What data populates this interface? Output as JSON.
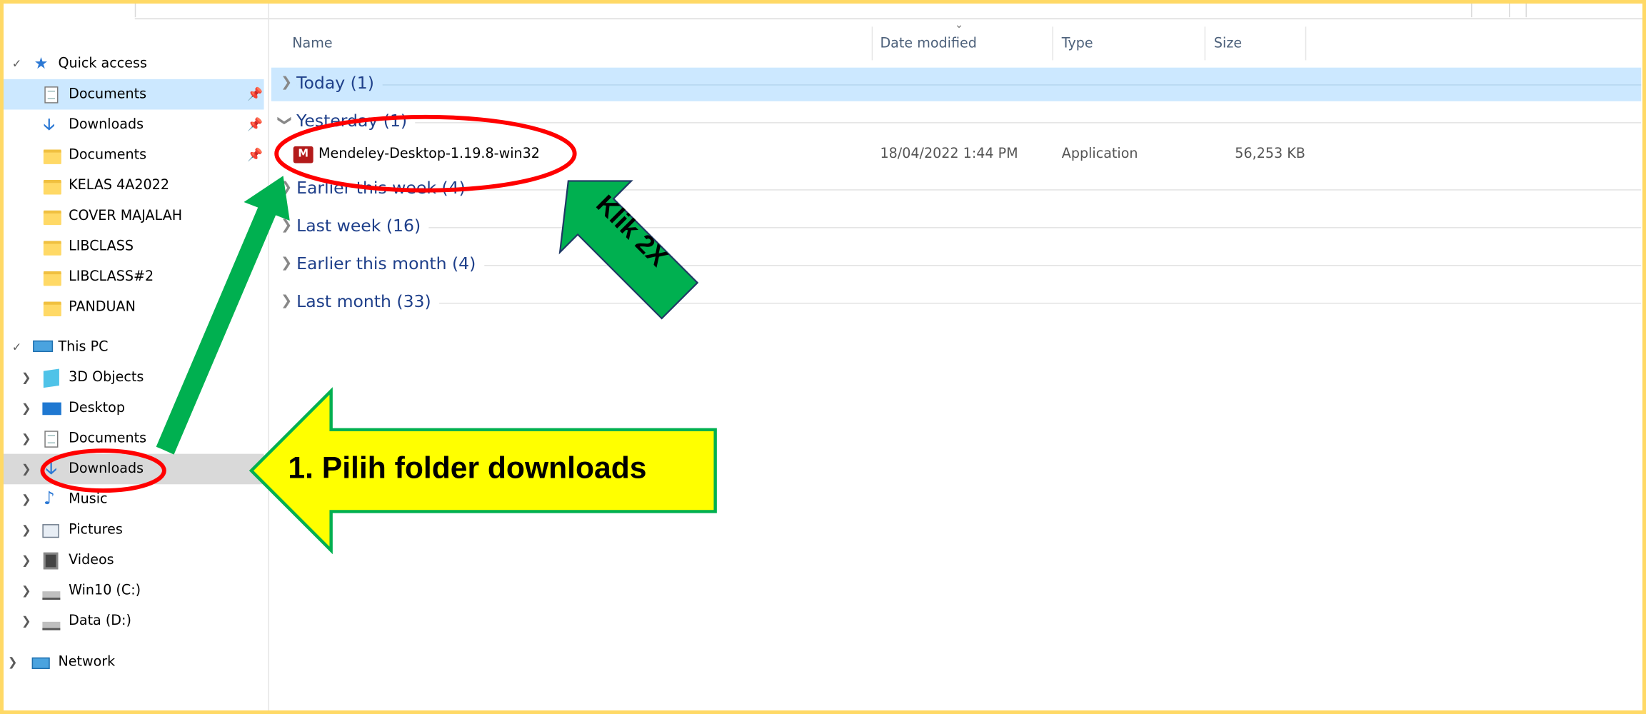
{
  "columns": {
    "name": "Name",
    "date_modified": "Date modified",
    "type": "Type",
    "size": "Size"
  },
  "nav": {
    "quick_access": "Quick access",
    "quick_items": [
      {
        "label": "Documents"
      },
      {
        "label": "Downloads"
      },
      {
        "label": "Documents"
      },
      {
        "label": "KELAS 4A2022"
      },
      {
        "label": "COVER MAJALAH"
      },
      {
        "label": "LIBCLASS"
      },
      {
        "label": "LIBCLASS#2"
      },
      {
        "label": "PANDUAN"
      }
    ],
    "this_pc": "This PC",
    "pc_items": [
      {
        "label": "3D Objects"
      },
      {
        "label": "Desktop"
      },
      {
        "label": "Documents"
      },
      {
        "label": "Downloads"
      },
      {
        "label": "Music"
      },
      {
        "label": "Pictures"
      },
      {
        "label": "Videos"
      },
      {
        "label": "Win10 (C:)"
      },
      {
        "label": "Data (D:)"
      }
    ],
    "network": "Network"
  },
  "groups": [
    {
      "label": "Today (1)"
    },
    {
      "label": "Yesterday (1)"
    },
    {
      "label": "Earlier this week (4)"
    },
    {
      "label": "Last week (16)"
    },
    {
      "label": "Earlier this month (4)"
    },
    {
      "label": "Last month (33)"
    }
  ],
  "file": {
    "name": "Mendeley-Desktop-1.19.8-win32",
    "date_modified": "18/04/2022 1:44 PM",
    "type": "Application",
    "size": "56,253 KB"
  },
  "annotations": {
    "callout": "1. Pilih folder downloads",
    "klik": "Klik 2X"
  },
  "colors": {
    "frame_border": "#ffd966",
    "selection": "#cce8ff",
    "callout_yellow": "#ffff00",
    "callout_border": "#00b050",
    "klik_green": "#00b050",
    "highlight_ellipse": "#ff0000"
  }
}
